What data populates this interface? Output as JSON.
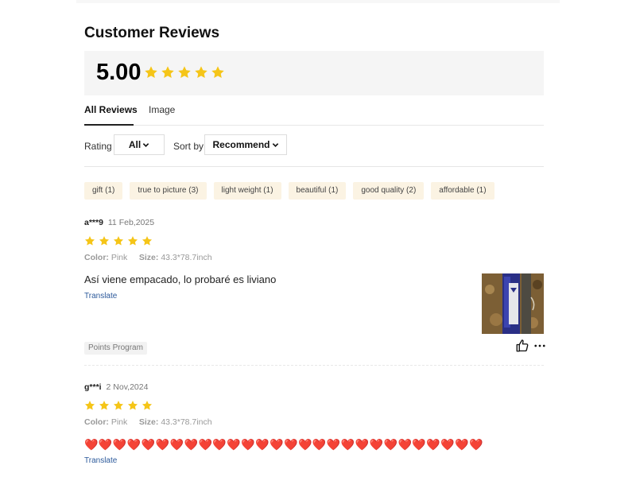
{
  "section": {
    "title": "Customer Reviews"
  },
  "summary": {
    "score": "5.00",
    "star_icons": [
      "star-filled-icon",
      "star-filled-icon",
      "star-filled-icon",
      "star-filled-icon",
      "star-filled-icon"
    ]
  },
  "tabs": [
    {
      "label": "All Reviews",
      "active": true
    },
    {
      "label": "Image",
      "active": false
    }
  ],
  "filters": {
    "rating_label": "Rating",
    "rating_value": "All",
    "sort_label": "Sort by",
    "sort_value": "Recommend"
  },
  "tags": [
    {
      "label": "gift (1)"
    },
    {
      "label": "true to picture (3)"
    },
    {
      "label": "light weight (1)"
    },
    {
      "label": "beautiful (1)"
    },
    {
      "label": "good quality (2)"
    },
    {
      "label": "affordable (1)"
    }
  ],
  "reviews": [
    {
      "user": "a***9",
      "date": "11 Feb,2025",
      "rating": 5,
      "color_label": "Color:",
      "color_value": "Pink",
      "size_label": "Size:",
      "size_value": "43.3*78.7inch",
      "text": "Así viene empacado, lo probaré es liviano",
      "translate_label": "Translate",
      "badge": "Points Program"
    },
    {
      "user": "g***i",
      "date": "2 Nov,2024",
      "rating": 5,
      "color_label": "Color:",
      "color_value": "Pink",
      "size_label": "Size:",
      "size_value": "43.3*78.7inch",
      "text": "❤️❤️❤️❤️❤️❤️❤️❤️❤️❤️❤️❤️❤️❤️❤️❤️❤️❤️❤️❤️❤️❤️❤️❤️❤️❤️❤️❤️",
      "translate_label": "Translate"
    }
  ],
  "colors": {
    "star": "#f5c518",
    "tag_bg": "#fbf3e3",
    "link": "#2d5a9b",
    "heart": "#d11111"
  }
}
